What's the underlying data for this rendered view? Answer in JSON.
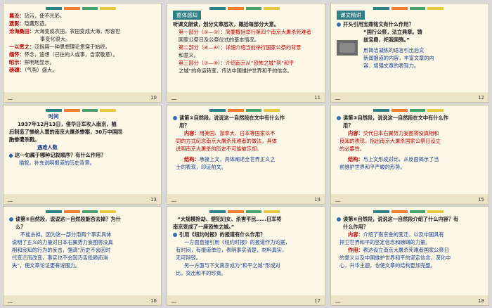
{
  "stripe_colors": [
    "#2f7f86",
    "#f08030",
    "#4aa06a",
    "#e8c640"
  ],
  "slides": {
    "s10": {
      "number": "10",
      "lines": [
        [
          "篡没：",
          "玷污，使不光彩。"
        ],
        [
          "遗影：",
          "隐藏形迹。"
        ],
        [
          "沧海桑田：",
          "大海变成农田，农田变成大海，形容世"
        ],
        [
          "",
          "事变化很大。"
        ],
        [
          "一以贯之：",
          "泛指用一种思想理论贯穿于始终。"
        ],
        [
          "缅怀：",
          "怀念，追想（已往的人或事，含崇敬意）。"
        ],
        [
          "昭示：",
          "鲜明地显示。"
        ],
        [
          "磅礴：",
          "（气势）盛大。"
        ]
      ]
    },
    "s11": {
      "number": "11",
      "tag": "整体感知",
      "lines": [
        "听课文朗读，划分文章层次，概括每部分大意。",
        "第一部分（①—③）：简要概括举行第四个南京大屠杀死难者",
        "国家公祭日及公祭仪式的基本情况。",
        "第二部分（④—⑥）：详细介绍当前举行国家公祭的背景",
        "和意义。",
        "第三部分（⑦—⑧）：介绍南京从“恐怖之城”到“和平",
        "之城”的命运转变，传达中国维护世界和平的信念。"
      ]
    },
    "s12": {
      "number": "12",
      "tag": "课文精讲",
      "q": "开头引用宝鼎铭文有什么作用？",
      "lines": [
        "“国行公祭，法立典章。铸",
        "兹宝鼎，祀我国殇。”",
        "",
        "用简洁凝练的语言引出后文",
        "新闻报道的内容，丰富文章的内",
        "容，增强文章的表现力。"
      ]
    },
    "s13": {
      "number": "13",
      "title": "时间",
      "lines": [
        "1937年12月13日，侵华日军攻入南京，随",
        "后制造了惨绝人寰的南京大屠杀惨案，30万中国同",
        "胞惨遭杀戮。"
      ],
      "title2": "遇难人数",
      "q": "这一句属于哪种记叙顺序？有什么作用？",
      "a": "插叙。补充说明报道的历史背景。"
    },
    "s14": {
      "number": "14",
      "q": "读第②自然段，说说这一自然段在文中有什么作",
      "q2": "用？",
      "lines": [
        "内容：用美国、加拿大、日本等国家以不",
        "同的方式纪念南京大屠杀死难者的做法，具体",
        "说明南京大屠杀的历史不可能被忘却。",
        "",
        "结构：承接上文，具体阐述全世界正义之",
        "士的表现，印证前文。"
      ]
    },
    "s15": {
      "number": "15",
      "q": "读第③自然段，说说这一自然段在文中有什么作",
      "q2": "用？",
      "lines": [
        "内容：交代日本右翼势力妄图将没真相和",
        "良知的表现，指出南京大屠杀国家公祭日设立",
        "的必要性。",
        "",
        "结构：与上文形成对比，从反面揭示了当",
        "前维护世界和平严峻的形势。"
      ]
    },
    "s16": {
      "number": "16",
      "q": "读第④自然段，说说这一自然段能否去掉？为什",
      "q2": "么？",
      "lines": [
        "不能去掉。因为这一部分用两个事实具体",
        "说明了正义的力量对日本右翼势力妄图将没真",
        "相和良知的行为的反击，强调“历史不会因时",
        "代变迁而改变，事实也不会因巧舌抵赖而消",
        "失”，使文章论证更有说服力。"
      ]
    },
    "s17": {
      "number": "17",
      "quote": [
        "“大规模抢劫、便犯妇女、杀害平民……日军将",
        "南京变成了一座恐怖之城。”"
      ],
      "q": "引用《纽约时报》的报道有什么作用？",
      "lines": [
        "一方面直接引用《纽约时报》的报道作为论据，",
        "有时间，有报道单位，表明事实清楚，材料真实，",
        "无可辩驳。",
        "另一方面与下文南京成为“和平之城”形成对",
        "比，突出和平的珍贵。"
      ]
    },
    "s18": {
      "number": "18",
      "q": "读第⑥自然段，说说这一自然段介绍了什么内容？有",
      "q2": "什么作用？",
      "lines": [
        "内容：介绍了南京金的变迁，以及中国具有",
        "捍卫世界和平的坚定信念和磅礴的力量。",
        "作用：表达设立南京大屠杀死难者国家公祭日",
        "的意义以及中国维护世界和平的坚定信念，深化中",
        "心，升华主题，也使文章的结构更加完整。"
      ]
    }
  }
}
